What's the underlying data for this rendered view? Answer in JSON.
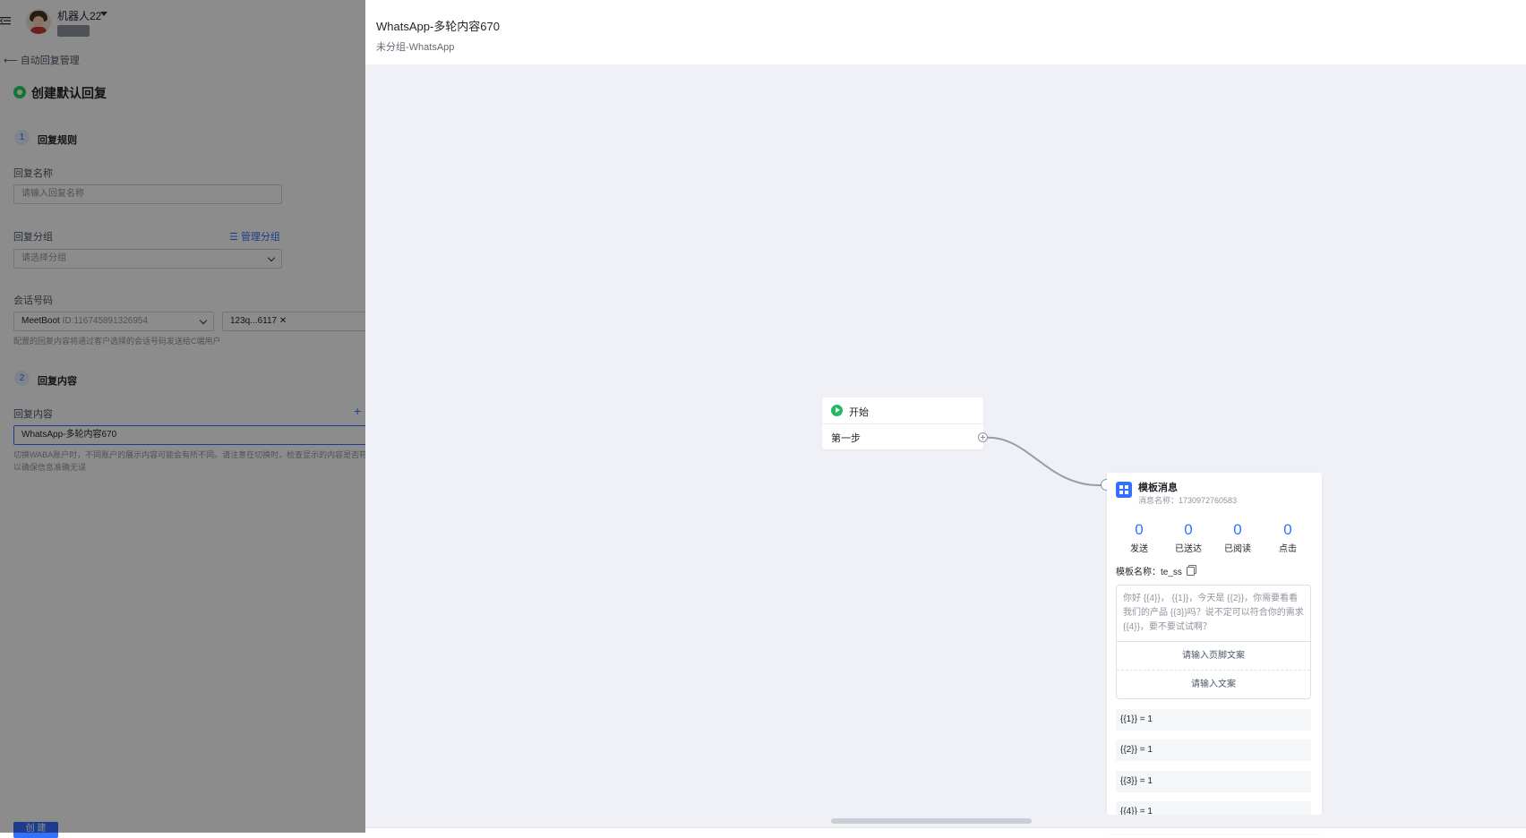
{
  "left_panel": {
    "robot_name": "机器人22",
    "back_link": "自动回复管理",
    "page_title": "创建默认回复",
    "section1": {
      "number": "1",
      "title": "回复规则"
    },
    "reply_name": {
      "label": "回复名称",
      "placeholder": "请输入回复名称"
    },
    "reply_group": {
      "label": "回复分组",
      "manage_link": "管理分组",
      "placeholder": "请选择分组"
    },
    "session_number": {
      "label": "会话号码",
      "select_name": "MeetBoot",
      "select_id": "ID:116745891326954",
      "tag": "123q...6117",
      "hint": "配置的回复内容将通过客户选择的会话号码发送给C端用户"
    },
    "section2": {
      "number": "2",
      "title": "回复内容"
    },
    "reply_content": {
      "label": "回复内容",
      "value": "WhatsApp-多轮内容670",
      "hint_line1": "切换WABA账户时，不同账户的展示内容可能会有所不同。请注意在切换时，检查显示的内容是否符",
      "hint_line2": "以确保信息准确无误"
    },
    "create_button": "创 建"
  },
  "drawer": {
    "title": "WhatsApp-多轮内容670",
    "subtitle": "未分组-WhatsApp",
    "start_node": {
      "label": "开始",
      "step": "第一步"
    },
    "template_node": {
      "title": "模板消息",
      "message_name": "消息名称：1730972760583",
      "stats": [
        {
          "value": "0",
          "label": "发送"
        },
        {
          "value": "0",
          "label": "已送达"
        },
        {
          "value": "0",
          "label": "已阅读"
        },
        {
          "value": "0",
          "label": "点击"
        }
      ],
      "template_name_label": "模板名称：",
      "template_name": "te_ss",
      "body_text": "你好 {{4}}， {{1}}，今天是 {{2}}，你需要看看我们的产品 {{3}}吗？说不定可以符合你的需求 {{4}}，要不要试试啊？",
      "footer_placeholder": "请输入页脚文案",
      "button_placeholder": "请输入文案",
      "variables": [
        "{{1}} = 1",
        "{{2}} = 1",
        "{{3}} = 1",
        "{{4}} = 1"
      ]
    }
  },
  "colors": {
    "accent": "#3370ff",
    "whatsapp": "#25d366",
    "canvas": "#f0f1f6"
  }
}
